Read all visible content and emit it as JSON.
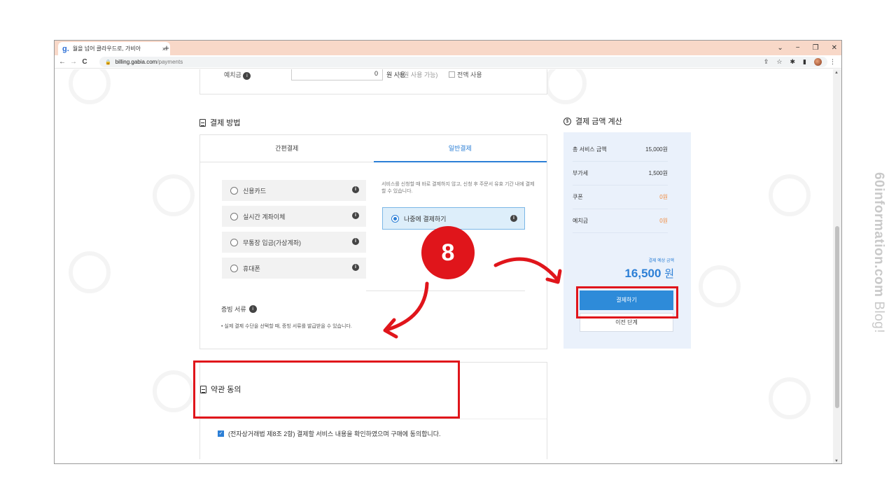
{
  "watermark": {
    "bold": "60information.com",
    "light": " Blog!"
  },
  "browser": {
    "tab_title": "월을 넘어 클라우드로, 가비아",
    "tab_close": "×",
    "new_tab": "+",
    "controls": {
      "chevron": "⌄",
      "minimize": "−",
      "restore": "❐",
      "close": "✕"
    },
    "nav": {
      "back": "←",
      "forward": "→",
      "reload": "C"
    },
    "url_host": "billing.gabia.com",
    "url_path": "/payments",
    "toolbar": {
      "share": "⇪",
      "star": "☆",
      "extensions": "✱",
      "sidebar": "▮",
      "menu": "⋮"
    }
  },
  "deposit": {
    "label": "예치금",
    "value": "0",
    "unit": "원 사용",
    "note": "(0원 사용 가능)",
    "use_all": "전액 사용"
  },
  "payment_method": {
    "title": "결제 방법",
    "tabs": [
      "간편결제",
      "일반결제"
    ],
    "methods": [
      "신용카드",
      "실시간 계좌이체",
      "무통장 입금(가상계좌)",
      "휴대폰"
    ],
    "description": "서비스를 신청할 때 바로 결제하지 않고, 신청 후 주문서 유효 기간 내에 결제할 수 있습니다.",
    "pay_later": "나중에 결제하기",
    "proof_title": "증빙 서류",
    "proof_note": "• 실제 결제 수단을 선택할 때, 증빙 서류를 발급받을 수 있습니다."
  },
  "calculation": {
    "title": "결제 금액 계산",
    "rows": [
      {
        "label": "총 서비스 금액",
        "value": "15,000원"
      },
      {
        "label": "부가세",
        "value": "1,500원"
      },
      {
        "label": "쿠폰",
        "value": "0원"
      },
      {
        "label": "예치금",
        "value": "0원"
      }
    ],
    "expected_label": "결제 예상 금액",
    "total": "16,500",
    "total_unit": "원",
    "pay_button": "결제하기",
    "prev_button": "이전 단계"
  },
  "terms": {
    "title": "약관 동의",
    "agree_text": "(전자상거래법 제8조 2항) 결제할 서비스 내용을 확인하였으며 구매에 동의합니다."
  },
  "annotation": {
    "step": "8"
  },
  "colors": {
    "accent": "#2c7fd6",
    "highlight": "#e0151b",
    "tabbar": "#f8d8c8"
  }
}
